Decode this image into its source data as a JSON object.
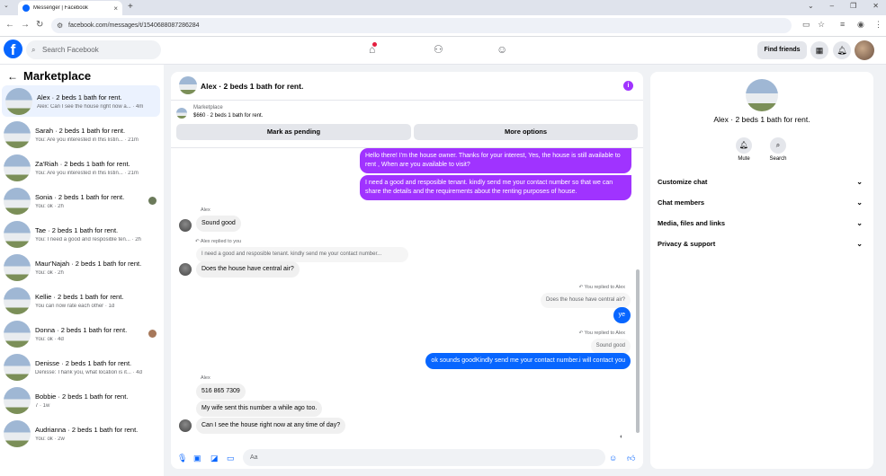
{
  "browser": {
    "tab_title": "Messenger | Facebook",
    "url": "facebook.com/messages/t/1540688087286284"
  },
  "facebook": {
    "search_placeholder": "Search Facebook",
    "find_friends": "Find friends"
  },
  "sidebar": {
    "title": "Marketplace",
    "conversations": [
      {
        "name": "Alex · 2 beds 1 bath for rent.",
        "preview": "Alex: Can I see the house right now a... · 4m",
        "active": true
      },
      {
        "name": "Sarah · 2 beds 1 bath for rent.",
        "preview": "You: Are you interested in this listin... · 21m"
      },
      {
        "name": "Za'Riah · 2 beds 1 bath for rent.",
        "preview": "You: Are you interested in this listin... · 21m"
      },
      {
        "name": "Sonia · 2 beds 1 bath for rent.",
        "preview": "You: ok · 2h"
      },
      {
        "name": "Tae · 2 beds 1 bath for rent.",
        "preview": "You: I need a good and resposible ten... · 2h"
      },
      {
        "name": "Maur'Najah · 2 beds 1 bath for rent.",
        "preview": "You: ok · 2h"
      },
      {
        "name": "Kellie · 2 beds 1 bath for rent.",
        "preview": "You can now rate each other · 1d"
      },
      {
        "name": "Donna · 2 beds 1 bath for rent.",
        "preview": "You: ok · 4d"
      },
      {
        "name": "Denisse · 2 beds 1 bath for rent.",
        "preview": "Denisse: Thank you, what location is it... · 4d"
      },
      {
        "name": "Bobbie · 2 beds 1 bath for rent.",
        "preview": "7 · 1w"
      },
      {
        "name": "Audrianna · 2 beds 1 bath for rent.",
        "preview": "You: ok · 2w"
      }
    ]
  },
  "chat": {
    "title": "Alex · 2 beds 1 bath for rent.",
    "marketplace_label": "Marketplace",
    "listing": "$660 · 2 beds 1 bath for rent.",
    "mark_pending": "Mark as pending",
    "more_options": "More options",
    "messages": {
      "m1": "Hello there! I'm the house owner. Thanks for your interest, Yes, the house is still available to rent , When are you available to visit?",
      "m2": "I need a good and resposible tenant.  kindly send me your contact number so that we can share the details and the requirements about the renting purposes of house.",
      "alex_label_1": "Alex",
      "m3": "Sound good",
      "replied_1": "Alex replied to you",
      "quote_1": "I need a good and resposible tenant.  kindly send me your contact number...",
      "m4": "Does the house have central air?",
      "replied_2": "You replied to Alex",
      "quote_2": "Does the house have central air?",
      "m5": "ye",
      "replied_3": "You replied to Alex",
      "quote_3": "Sound good",
      "m6": "ok sounds goodKindly send me your contact number.i will contact you",
      "alex_label_2": "Alex",
      "m7": "516 865 7309",
      "m8": "My wife sent this number a while ago too.",
      "m9": "Can I see the house right now at any time of day?"
    },
    "input_placeholder": "Aa"
  },
  "details": {
    "name": "Alex · 2 beds 1 bath for rent.",
    "mute": "Mute",
    "search": "Search",
    "items": [
      "Customize chat",
      "Chat members",
      "Media, files and links",
      "Privacy & support"
    ]
  }
}
